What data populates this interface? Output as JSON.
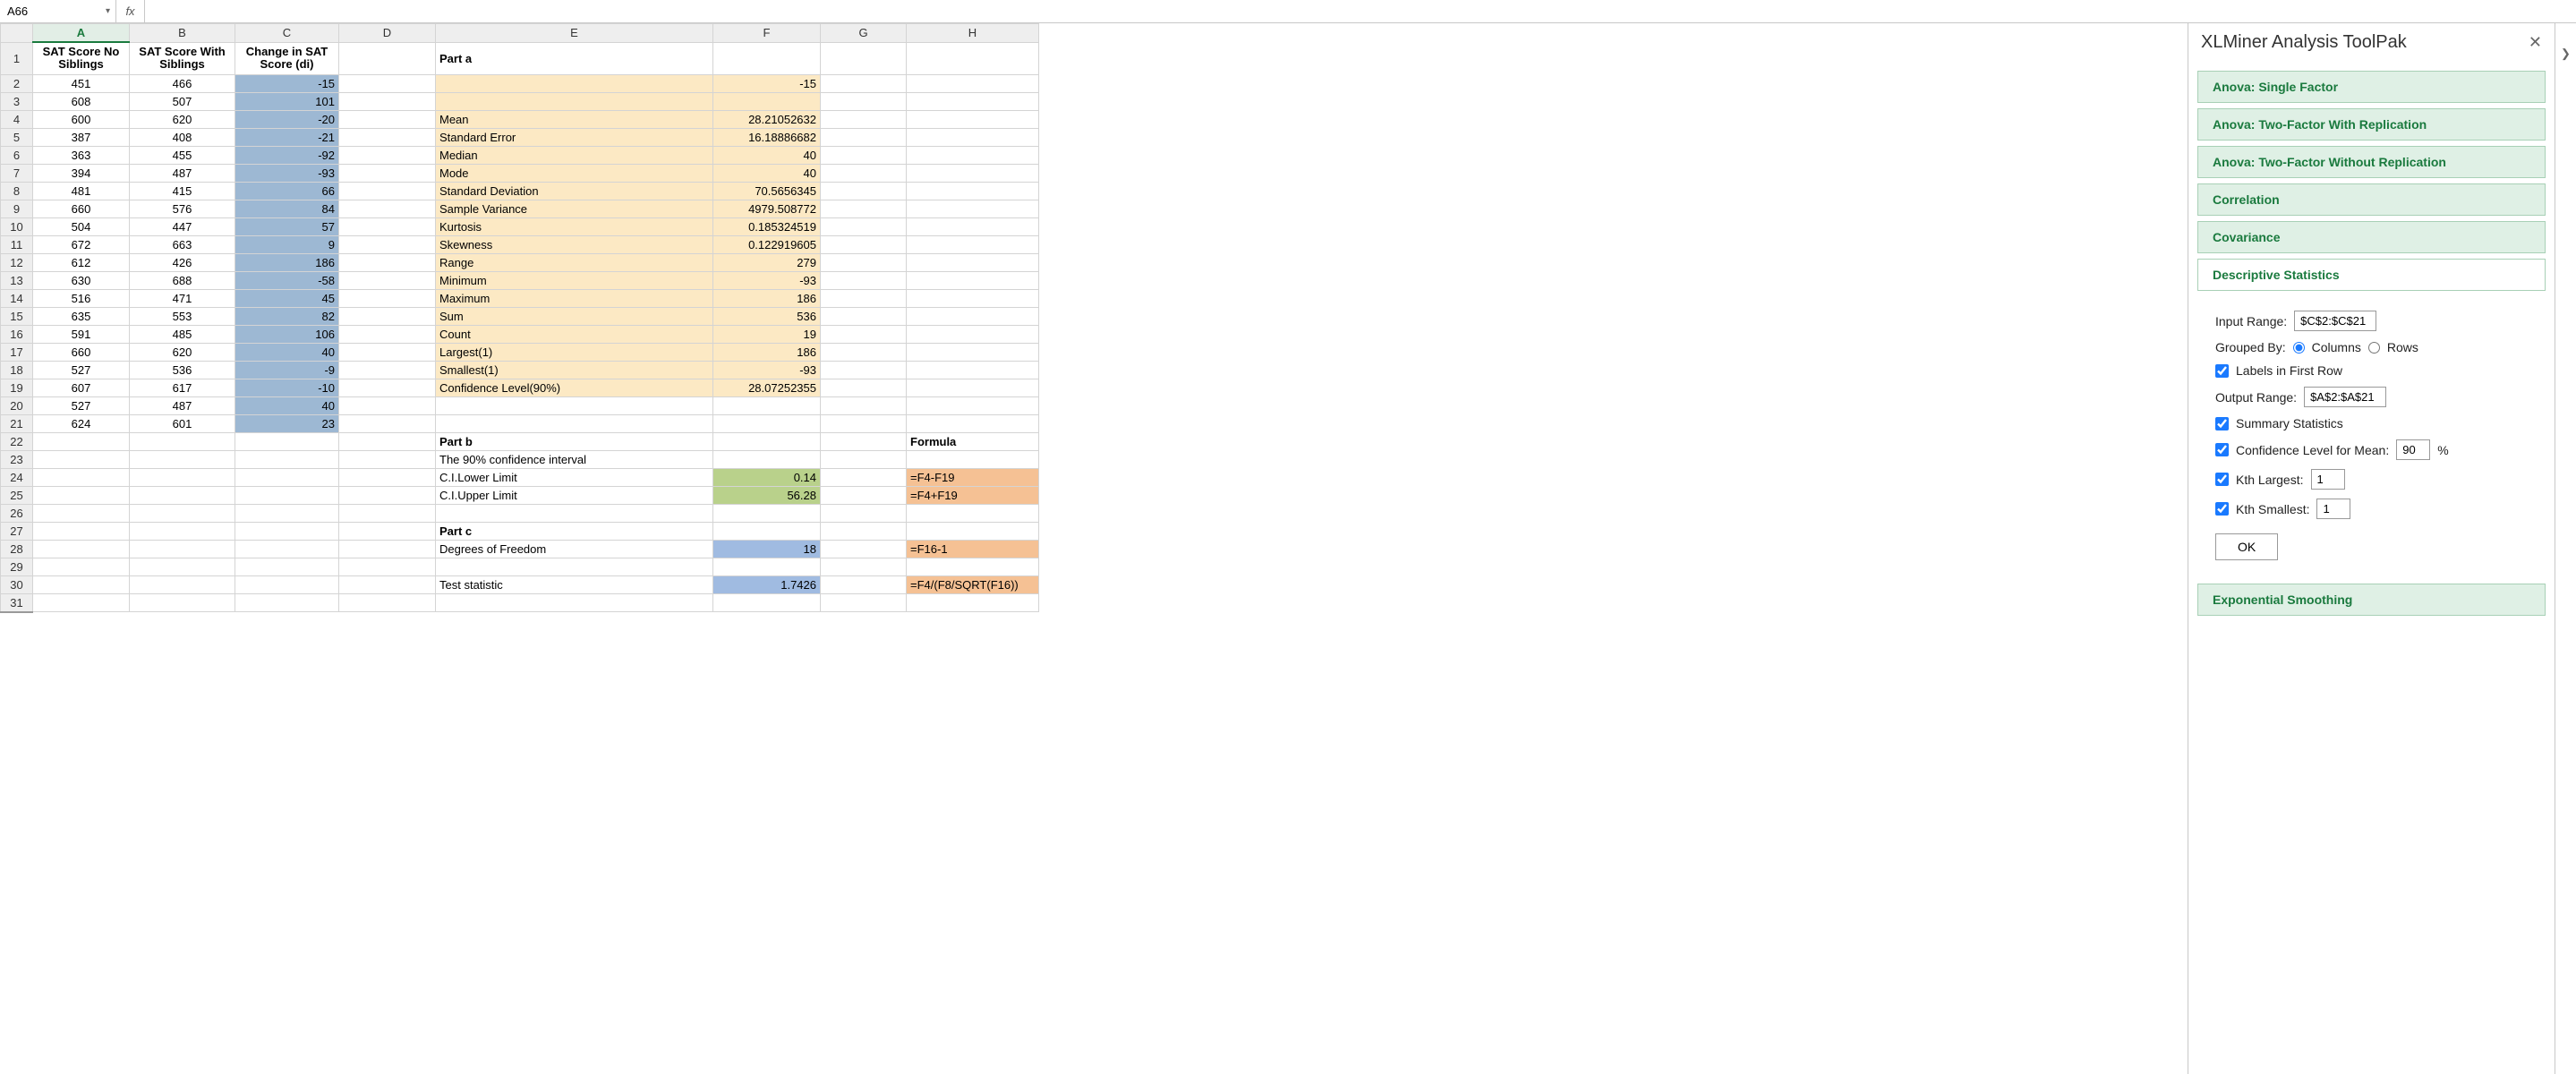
{
  "nameBox": "A66",
  "fxLabel": "fx",
  "columns": [
    "A",
    "B",
    "C",
    "D",
    "E",
    "F",
    "G",
    "H"
  ],
  "selectedCol": "A",
  "headers": {
    "A": "SAT Score   No Siblings",
    "B": "SAT Score With Siblings",
    "C": "Change in SAT Score (di)"
  },
  "data": {
    "rows": [
      {
        "a": "451",
        "b": "466",
        "c": "-15"
      },
      {
        "a": "608",
        "b": "507",
        "c": "101"
      },
      {
        "a": "600",
        "b": "620",
        "c": "-20"
      },
      {
        "a": "387",
        "b": "408",
        "c": "-21"
      },
      {
        "a": "363",
        "b": "455",
        "c": "-92"
      },
      {
        "a": "394",
        "b": "487",
        "c": "-93"
      },
      {
        "a": "481",
        "b": "415",
        "c": "66"
      },
      {
        "a": "660",
        "b": "576",
        "c": "84"
      },
      {
        "a": "504",
        "b": "447",
        "c": "57"
      },
      {
        "a": "672",
        "b": "663",
        "c": "9"
      },
      {
        "a": "612",
        "b": "426",
        "c": "186"
      },
      {
        "a": "630",
        "b": "688",
        "c": "-58"
      },
      {
        "a": "516",
        "b": "471",
        "c": "45"
      },
      {
        "a": "635",
        "b": "553",
        "c": "82"
      },
      {
        "a": "591",
        "b": "485",
        "c": "106"
      },
      {
        "a": "660",
        "b": "620",
        "c": "40"
      },
      {
        "a": "527",
        "b": "536",
        "c": "-9"
      },
      {
        "a": "607",
        "b": "617",
        "c": "-10"
      },
      {
        "a": "527",
        "b": "487",
        "c": "40"
      },
      {
        "a": "624",
        "b": "601",
        "c": "23"
      }
    ]
  },
  "partA": {
    "title": "Part a",
    "topVal": "-15",
    "stats": [
      {
        "label": "Mean",
        "val": "28.21052632"
      },
      {
        "label": "Standard Error",
        "val": "16.18886682"
      },
      {
        "label": "Median",
        "val": "40"
      },
      {
        "label": "Mode",
        "val": "40"
      },
      {
        "label": "Standard Deviation",
        "val": "70.5656345"
      },
      {
        "label": "Sample Variance",
        "val": "4979.508772"
      },
      {
        "label": "Kurtosis",
        "val": "0.185324519"
      },
      {
        "label": "Skewness",
        "val": "0.122919605"
      },
      {
        "label": "Range",
        "val": "279"
      },
      {
        "label": "Minimum",
        "val": "-93"
      },
      {
        "label": "Maximum",
        "val": "186"
      },
      {
        "label": "Sum",
        "val": "536"
      },
      {
        "label": "Count",
        "val": "19"
      },
      {
        "label": "Largest(1)",
        "val": "186"
      },
      {
        "label": "Smallest(1)",
        "val": "-93"
      },
      {
        "label": "Confidence Level(90%)",
        "val": "28.07252355"
      }
    ]
  },
  "partB": {
    "title": "Part b",
    "sub": "The 90% confidence interval",
    "formulaHdr": "Formula",
    "lower": {
      "label": "C.I.Lower Limit",
      "val": "0.14",
      "formula": "=F4-F19"
    },
    "upper": {
      "label": "C.I.Upper Limit",
      "val": "56.28",
      "formula": "=F4+F19"
    }
  },
  "partC": {
    "title": "Part c",
    "dof": {
      "label": "Degrees of Freedom",
      "val": "18",
      "formula": "=F16-1"
    },
    "tstat": {
      "label": "Test statistic",
      "val": "1.7426",
      "formula": "=F4/(F8/SQRT(F16))"
    }
  },
  "panel": {
    "title": "XLMiner Analysis ToolPak",
    "tools": [
      "Anova: Single Factor",
      "Anova: Two-Factor With Replication",
      "Anova: Two-Factor Without Replication",
      "Correlation",
      "Covariance",
      "Descriptive Statistics",
      "Exponential Smoothing"
    ],
    "form": {
      "inputRangeLabel": "Input Range:",
      "inputRange": "$C$2:$C$21",
      "groupedByLabel": "Grouped By:",
      "columnsLabel": "Columns",
      "rowsLabel": "Rows",
      "labelsFirstRow": "Labels in First Row",
      "outputRangeLabel": "Output Range:",
      "outputRange": "$A$2:$A$21",
      "summaryStats": "Summary Statistics",
      "confLevelLabel": "Confidence Level for Mean:",
      "confLevel": "90",
      "pct": "%",
      "kthLargestLabel": "Kth Largest:",
      "kthLargest": "1",
      "kthSmallestLabel": "Kth Smallest:",
      "kthSmallest": "1",
      "ok": "OK"
    }
  }
}
